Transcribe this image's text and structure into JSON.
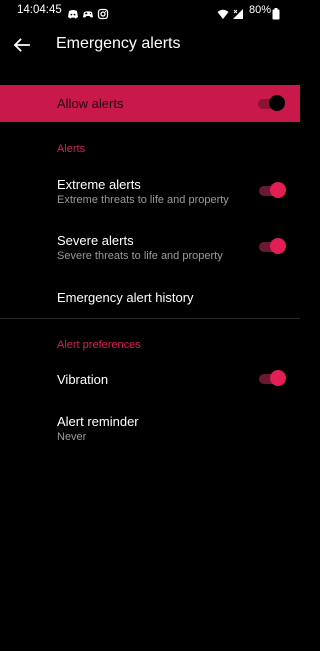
{
  "status_bar": {
    "time": "14:04:45",
    "battery": "80%",
    "icons": [
      "discord-icon",
      "game-controller-icon",
      "instagram-icon",
      "wifi-icon",
      "signal-icon",
      "battery-icon"
    ]
  },
  "app_bar": {
    "title": "Emergency alerts",
    "back_icon": "arrow-back-icon"
  },
  "master": {
    "label": "Allow alerts",
    "enabled": true
  },
  "sections": {
    "alerts": {
      "header": "Alerts",
      "items": [
        {
          "title": "Extreme alerts",
          "subtitle": "Extreme threats to life and property",
          "enabled": true
        },
        {
          "title": "Severe alerts",
          "subtitle": "Severe threats to life and property",
          "enabled": true
        },
        {
          "title": "Emergency alert history"
        }
      ]
    },
    "preferences": {
      "header": "Alert preferences",
      "items": [
        {
          "title": "Vibration",
          "enabled": true
        },
        {
          "title": "Alert reminder",
          "subtitle": "Never"
        }
      ]
    }
  },
  "colors": {
    "accent": "#c8194a",
    "accent_text": "#d61f52",
    "background": "#000000",
    "subtitle": "#9a9a9a"
  }
}
